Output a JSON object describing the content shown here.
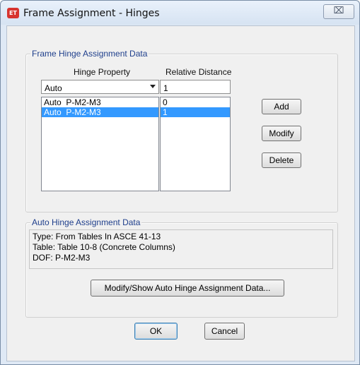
{
  "window": {
    "app_icon_text": "ET",
    "title": "Frame Assignment - Hinges",
    "close_glyph": "⌧"
  },
  "hinge_group": {
    "title": "Frame Hinge Assignment Data",
    "col_hinge_property": "Hinge Property",
    "col_relative_distance": "Relative Distance",
    "hinge_property_value": "Auto",
    "relative_distance_value": "1",
    "rows": [
      {
        "property": "Auto  P-M2-M3",
        "distance": "0",
        "selected": false
      },
      {
        "property": "Auto  P-M2-M3",
        "distance": "1",
        "selected": true
      }
    ],
    "add_label": "Add",
    "modify_label": "Modify",
    "delete_label": "Delete"
  },
  "auto_group": {
    "title": "Auto Hinge Assignment Data",
    "lines": [
      "Type:  From Tables In ASCE 41-13",
      "Table:  Table 10-8 (Concrete Columns)",
      "DOF:  P-M2-M3"
    ],
    "modify_show_label": "Modify/Show Auto Hinge Assignment Data..."
  },
  "footer": {
    "ok_label": "OK",
    "cancel_label": "Cancel"
  },
  "colors": {
    "selection": "#3399ff",
    "group_title": "#1f3f8c",
    "app_icon": "#d7342f"
  }
}
